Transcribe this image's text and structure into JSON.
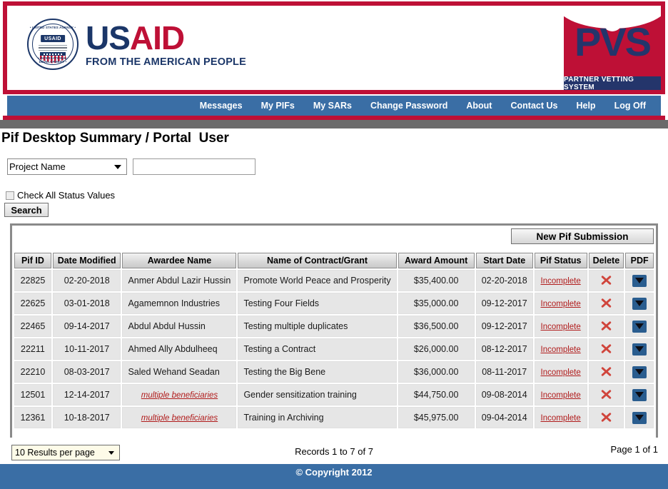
{
  "header": {
    "usaid": {
      "seal_top_arc": "• UNITED STATES AGENCY •",
      "seal_bottom_arc": "• INTERNATIONAL DEVELOPMENT •",
      "seal_badge": "USAID",
      "word_us": "US",
      "word_aid": "AID",
      "tagline": "FROM THE AMERICAN PEOPLE"
    },
    "pvs": {
      "acronym": "PVS",
      "subtitle": "PARTNER VETTING SYSTEM"
    },
    "colors": {
      "crimson": "#be1036",
      "navy": "#24356b",
      "nav_blue": "#3a6ea5",
      "gray_strip": "#6b6b6b"
    }
  },
  "nav": {
    "items": [
      {
        "label": "Messages"
      },
      {
        "label": "My PIFs"
      },
      {
        "label": "My SARs"
      },
      {
        "label": "Change Password"
      },
      {
        "label": "About"
      },
      {
        "label": "Contact Us"
      },
      {
        "label": "Help"
      },
      {
        "label": "Log Off"
      }
    ]
  },
  "page": {
    "title": "Pif Desktop Summary / Portal  User"
  },
  "search": {
    "field_selected": "Project Name",
    "field_options": [
      "Project Name"
    ],
    "text_value": "",
    "text_placeholder": "",
    "checkbox_label": "Check All Status Values",
    "checkbox_checked": false,
    "button_label": "Search"
  },
  "toolbar": {
    "new_pif_label": "New Pif Submission"
  },
  "table": {
    "columns": [
      "Pif ID",
      "Date Modified",
      "Awardee Name",
      "Name of Contract/Grant",
      "Award Amount",
      "Start Date",
      "Pif Status",
      "Delete",
      "PDF"
    ],
    "rows": [
      {
        "pif_id": "22825",
        "date_modified": "02-20-2018",
        "awardee_name": "Anmer Abdul Lazir Hussin",
        "awardee_is_link": false,
        "contract_name": "Promote World Peace and Prosperity",
        "award_amount": "$35,400.00",
        "start_date": "02-20-2018",
        "pif_status": "Incomplete"
      },
      {
        "pif_id": "22625",
        "date_modified": "03-01-2018",
        "awardee_name": "Agamemnon Industries",
        "awardee_is_link": false,
        "contract_name": "Testing Four Fields",
        "award_amount": "$35,000.00",
        "start_date": "09-12-2017",
        "pif_status": "Incomplete"
      },
      {
        "pif_id": "22465",
        "date_modified": "09-14-2017",
        "awardee_name": "Abdul Abdul Hussin",
        "awardee_is_link": false,
        "contract_name": "Testing multiple duplicates",
        "award_amount": "$36,500.00",
        "start_date": "09-12-2017",
        "pif_status": "Incomplete"
      },
      {
        "pif_id": "22211",
        "date_modified": "10-11-2017",
        "awardee_name": "Ahmed Ally Abdulheeq",
        "awardee_is_link": false,
        "contract_name": "Testing a Contract",
        "award_amount": "$26,000.00",
        "start_date": "08-12-2017",
        "pif_status": "Incomplete"
      },
      {
        "pif_id": "22210",
        "date_modified": "08-03-2017",
        "awardee_name": "Saled Wehand Seadan",
        "awardee_is_link": false,
        "contract_name": "Testing the Big Bene",
        "award_amount": "$36,000.00",
        "start_date": "08-11-2017",
        "pif_status": "Incomplete"
      },
      {
        "pif_id": "12501",
        "date_modified": "12-14-2017",
        "awardee_name": "multiple beneficiaries",
        "awardee_is_link": true,
        "contract_name": "Gender sensitization training",
        "award_amount": "$44,750.00",
        "start_date": "09-08-2014",
        "pif_status": "Incomplete"
      },
      {
        "pif_id": "12361",
        "date_modified": "10-18-2017",
        "awardee_name": "multiple beneficiaries",
        "awardee_is_link": true,
        "contract_name": "Training in Archiving",
        "award_amount": "$45,975.00",
        "start_date": "09-04-2014",
        "pif_status": "Incomplete"
      }
    ],
    "icons": {
      "delete": "delete-x-icon",
      "pdf": "pdf-download-icon"
    }
  },
  "footer": {
    "per_page_selected": "10 Results per page",
    "per_page_options": [
      "10 Results per page"
    ],
    "records_text": "Records 1 to 7 of 7",
    "page_text": "Page 1 of 1",
    "copyright": "© Copyright 2012"
  }
}
